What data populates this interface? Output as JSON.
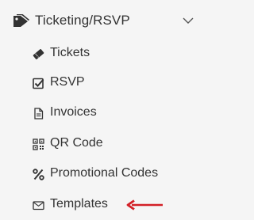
{
  "menu": {
    "header": {
      "title": "Ticketing/RSVP",
      "icon": "tag-icon"
    },
    "expand_icon": "chevron-down-icon",
    "items": [
      {
        "label": "Tickets",
        "icon": "ticket-icon"
      },
      {
        "label": "RSVP",
        "icon": "checkbox-icon"
      },
      {
        "label": "Invoices",
        "icon": "document-icon"
      },
      {
        "label": "QR Code",
        "icon": "qr-code-icon"
      },
      {
        "label": "Promotional Codes",
        "icon": "percent-icon"
      },
      {
        "label": "Templates",
        "icon": "envelope-icon"
      }
    ]
  },
  "colors": {
    "text": "#333333",
    "background": "#f5f5f5",
    "annotation_arrow": "#d32027"
  }
}
